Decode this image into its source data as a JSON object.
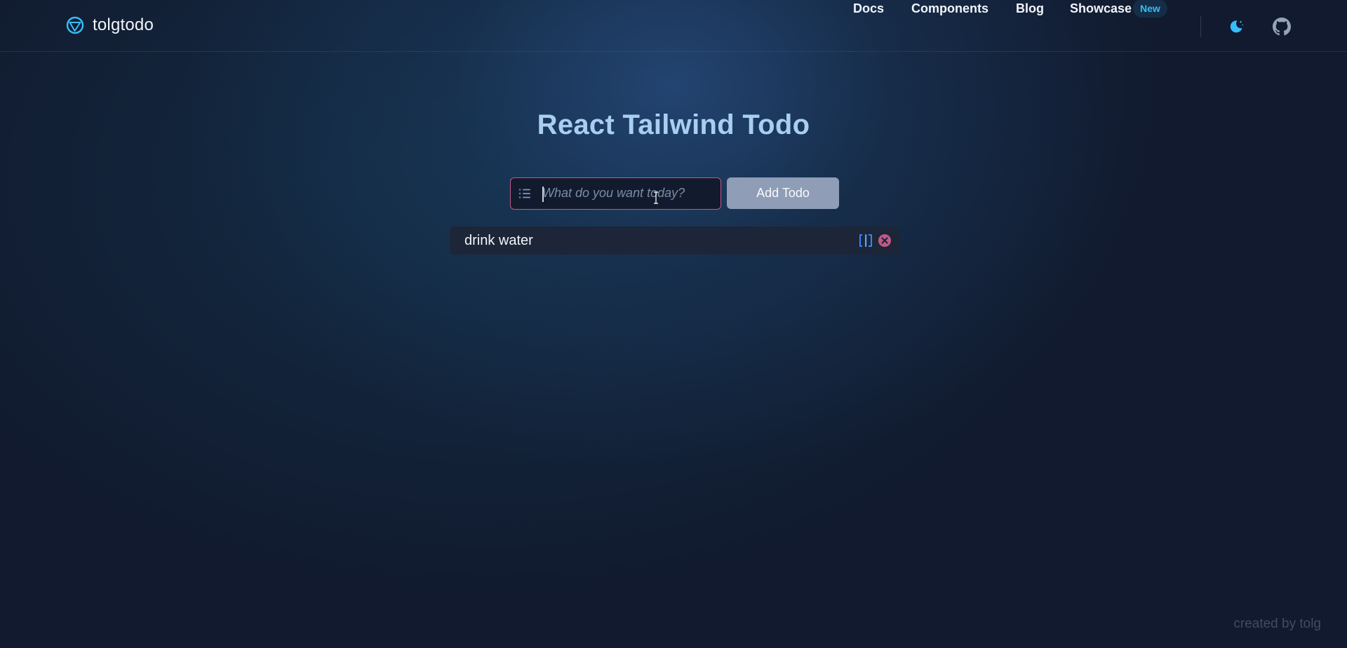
{
  "header": {
    "brand": "tolgtodo",
    "nav": [
      {
        "label": "Docs"
      },
      {
        "label": "Components"
      },
      {
        "label": "Blog"
      },
      {
        "label": "Showcase",
        "badge": "New"
      }
    ],
    "icons": [
      "moon-icon",
      "github-icon"
    ]
  },
  "main": {
    "title": "React Tailwind Todo",
    "input": {
      "placeholder": "What do you want today?",
      "value": ""
    },
    "add_button_label": "Add Todo",
    "todos": [
      {
        "text": "drink water"
      }
    ]
  },
  "footer": {
    "credit": "created by tolg"
  },
  "colors": {
    "accent": "#38bdf8",
    "title": "#a8cff0",
    "input_border": "#be5b88",
    "button_bg": "#8f9db6",
    "delete": "#be5b88"
  }
}
